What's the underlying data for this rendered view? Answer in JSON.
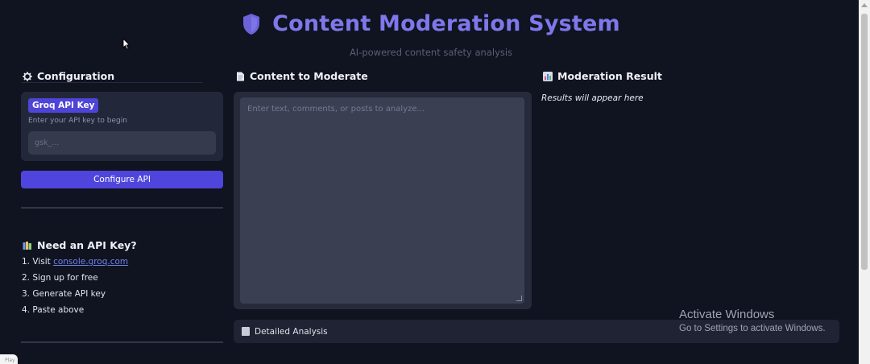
{
  "header": {
    "title": "Content Moderation System",
    "subtitle": "AI-powered content safety analysis",
    "accent_color": "#7f77ea",
    "icon": "shield-icon"
  },
  "sidebar": {
    "configuration": {
      "heading": "Configuration",
      "icon": "gear-icon",
      "badge": "Groq API Key",
      "help_text": "Enter your API key to begin",
      "input_placeholder": "gsk_...",
      "input_value": "",
      "button_label": "Configure API"
    },
    "help": {
      "heading": "Need an API Key?",
      "icon": "books-icon",
      "steps": [
        {
          "prefix": "1. Visit ",
          "link": "console.groq.com"
        },
        {
          "text": "2. Sign up for free"
        },
        {
          "text": "3. Generate API key"
        },
        {
          "text": "4. Paste above"
        }
      ]
    }
  },
  "main": {
    "content": {
      "heading": "Content to Moderate",
      "icon": "document-icon",
      "placeholder": "Enter text, comments, or posts to analyze...",
      "value": ""
    },
    "result": {
      "heading": "Moderation Result",
      "icon": "bar-chart-icon",
      "placeholder": "Results will appear here"
    },
    "analysis": {
      "label": "Detailed Analysis",
      "icon": "clipboard-icon"
    }
  },
  "watermark": {
    "title": "Activate Windows",
    "subtitle": "Go to Settings to activate Windows."
  },
  "overlay": {
    "play_label": "Play"
  },
  "colors": {
    "background": "#101320",
    "primary_button": "#4f45dd",
    "card": "#23273a",
    "link": "#6f82e8"
  }
}
